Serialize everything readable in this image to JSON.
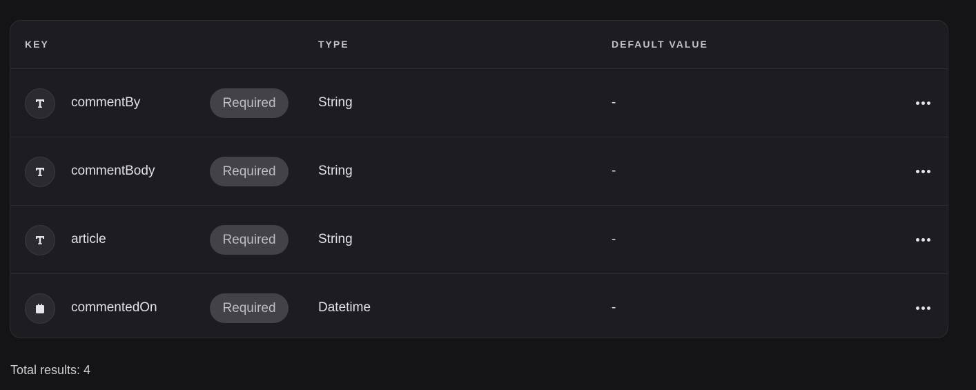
{
  "table": {
    "headers": {
      "key": "KEY",
      "type": "TYPE",
      "default_value": "DEFAULT VALUE"
    },
    "rows": [
      {
        "icon": "text-type-icon",
        "key": "commentBy",
        "badge": "Required",
        "type": "String",
        "default": "-"
      },
      {
        "icon": "text-type-icon",
        "key": "commentBody",
        "badge": "Required",
        "type": "String",
        "default": "-"
      },
      {
        "icon": "text-type-icon",
        "key": "article",
        "badge": "Required",
        "type": "String",
        "default": "-"
      },
      {
        "icon": "calendar-icon",
        "key": "commentedOn",
        "badge": "Required",
        "type": "Datetime",
        "default": "-"
      }
    ]
  },
  "footer": {
    "total_results": "Total results: 4"
  },
  "colors": {
    "page_bg": "#141416",
    "table_bg": "#1d1d21",
    "badge_bg": "#424248"
  }
}
